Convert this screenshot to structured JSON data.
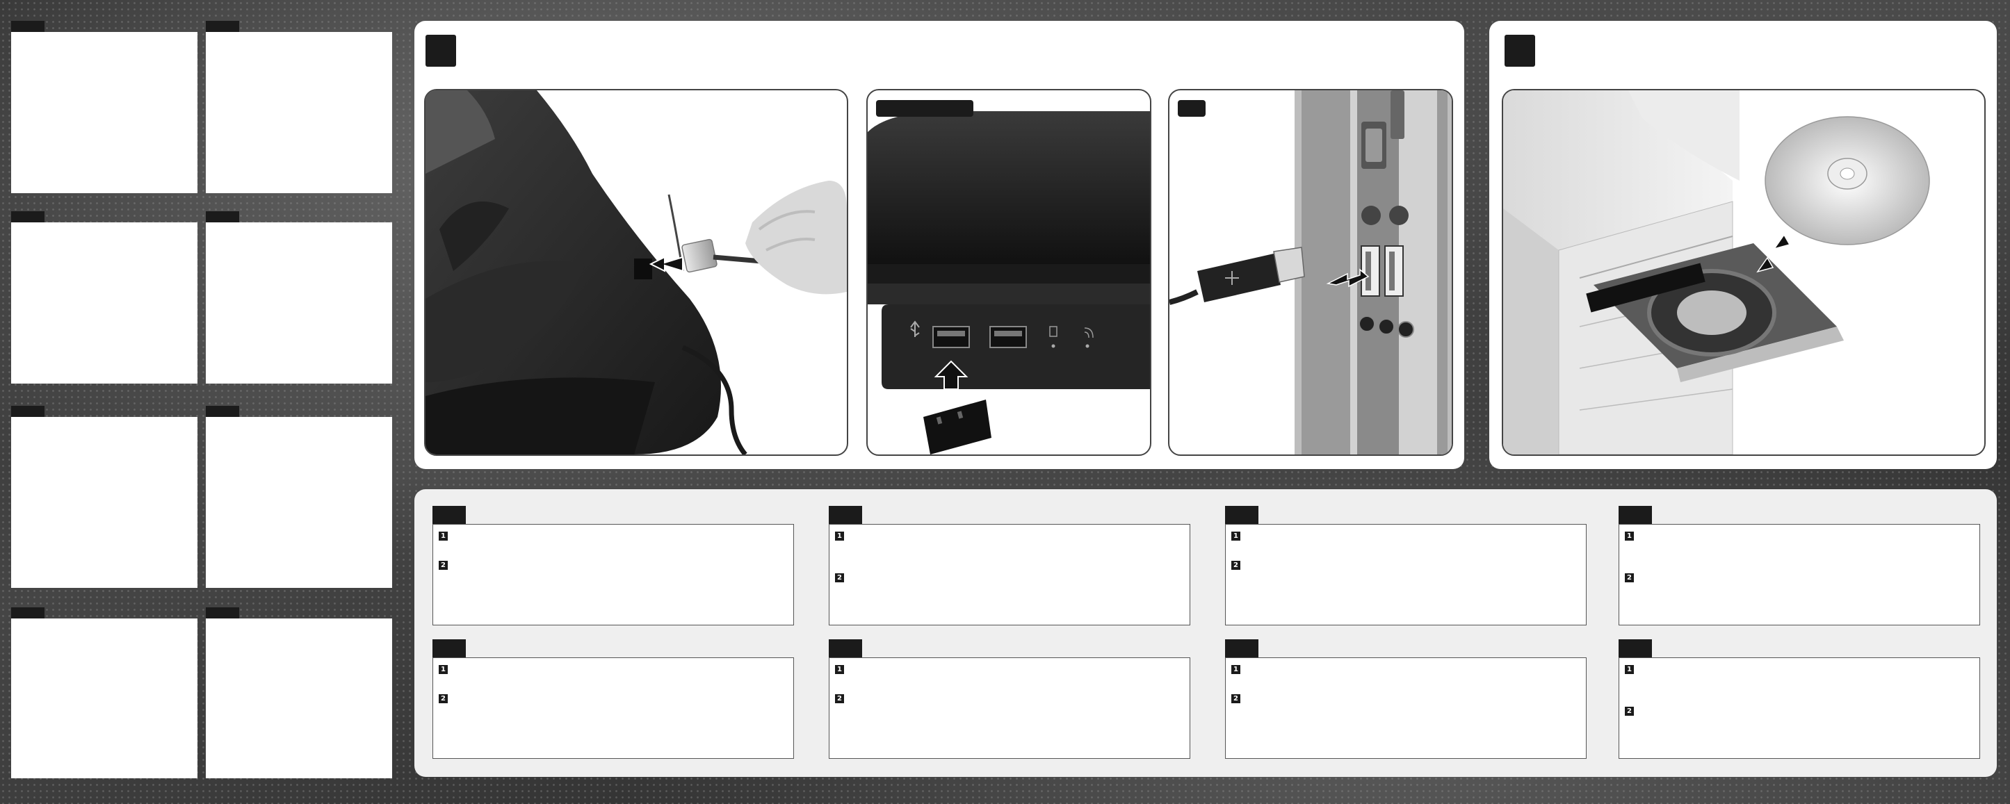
{
  "steps": {
    "numbers": [
      "1",
      "2"
    ]
  },
  "icons": {
    "usb_symbol": "usb-icon",
    "hdd_led": "hdd-led-icon",
    "wifi_led": "wireless-icon",
    "arrow": "arrow-icon"
  },
  "colors": {
    "badge": "#1b1b1b",
    "panel": "#ffffff",
    "panel_grey": "#efefef"
  }
}
